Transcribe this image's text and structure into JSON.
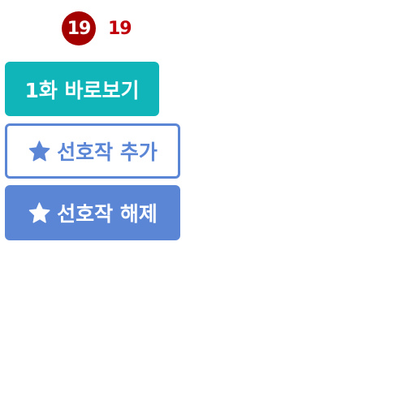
{
  "age_rating": {
    "badge_text": "19",
    "label": "19",
    "badge_color": "#a50000",
    "label_color": "#c0000a"
  },
  "buttons": {
    "view_first": {
      "label": "1화 바로보기",
      "background": "#0fb5b8"
    },
    "add_favorite": {
      "label": "선호작 추가",
      "color": "#5b86d6",
      "icon": "star-icon"
    },
    "remove_favorite": {
      "label": "선호작 해제",
      "background": "#5b86d6",
      "icon": "star-icon"
    }
  }
}
